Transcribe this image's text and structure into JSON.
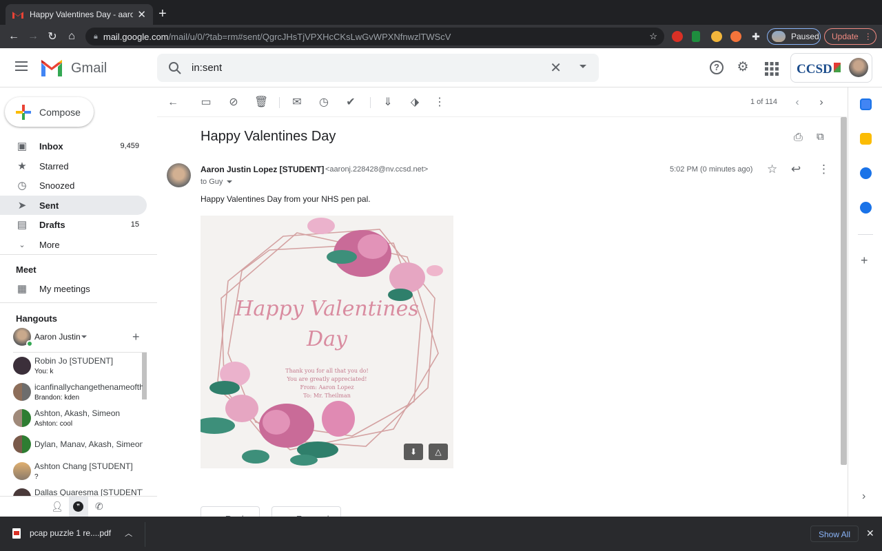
{
  "browser": {
    "tab_title": "Happy Valentines Day - aaronj",
    "url_domain": "mail.google.com",
    "url_path": "/mail/u/0/?tab=rm#sent/QgrcJHsTjVPXHcCKsLwGvWPXNfnwzlTWScV",
    "paused_label": "Paused",
    "update_label": "Update"
  },
  "gmail": {
    "logo_text": "Gmail",
    "search_query": "in:sent",
    "account_org": "CCSD"
  },
  "sidebar": {
    "compose_label": "Compose",
    "items": [
      {
        "label": "Inbox",
        "count": "9,459"
      },
      {
        "label": "Starred",
        "count": ""
      },
      {
        "label": "Snoozed",
        "count": ""
      },
      {
        "label": "Sent",
        "count": ""
      },
      {
        "label": "Drafts",
        "count": "15"
      },
      {
        "label": "More",
        "count": ""
      }
    ],
    "meet_title": "Meet",
    "meet_item": "My meetings",
    "hangouts_title": "Hangouts",
    "hangouts_user": "Aaron Justin",
    "conversations": [
      {
        "name": "Robin Jo [STUDENT]",
        "preview": "You: k"
      },
      {
        "name": "icanfinallychangethenameofthi",
        "preview": "Brandon: kden"
      },
      {
        "name": "Ashton, Akash, Simeon",
        "preview": "Ashton: cool"
      },
      {
        "name": "Dylan, Manav, Akash, Simeon",
        "preview": ""
      },
      {
        "name": "Ashton Chang [STUDENT]",
        "preview": "?"
      },
      {
        "name": "Dallas Quaresma [STUDENT]",
        "preview": ""
      }
    ]
  },
  "message": {
    "pager": "1 of 114",
    "subject": "Happy Valentines Day",
    "sender_name": "Aaron Justin Lopez [STUDENT]",
    "sender_email": "<aaronj.228428@nv.ccsd.net>",
    "to_line": "to Guy",
    "time": "5:02 PM (0 minutes ago)",
    "body": "Happy Valentines Day from your NHS pen pal.",
    "card_line1": "Happy Valentines",
    "card_line2": "Day",
    "card_msg1": "Thank you for all that you do!",
    "card_msg2": "You are greatly appreciated!",
    "card_msg3": "From: Aaron Lopez",
    "card_msg4": "To: Mr. Theilman",
    "reply_label": "Reply",
    "forward_label": "Forward"
  },
  "downloads": {
    "file_name": "pcap puzzle 1 re....pdf",
    "show_all": "Show All"
  },
  "colors": {
    "gmail_red": "#ea4335",
    "google_blue": "#4285f4",
    "active_nav": "#e8eaed",
    "card_pink": "#d98ca0"
  }
}
